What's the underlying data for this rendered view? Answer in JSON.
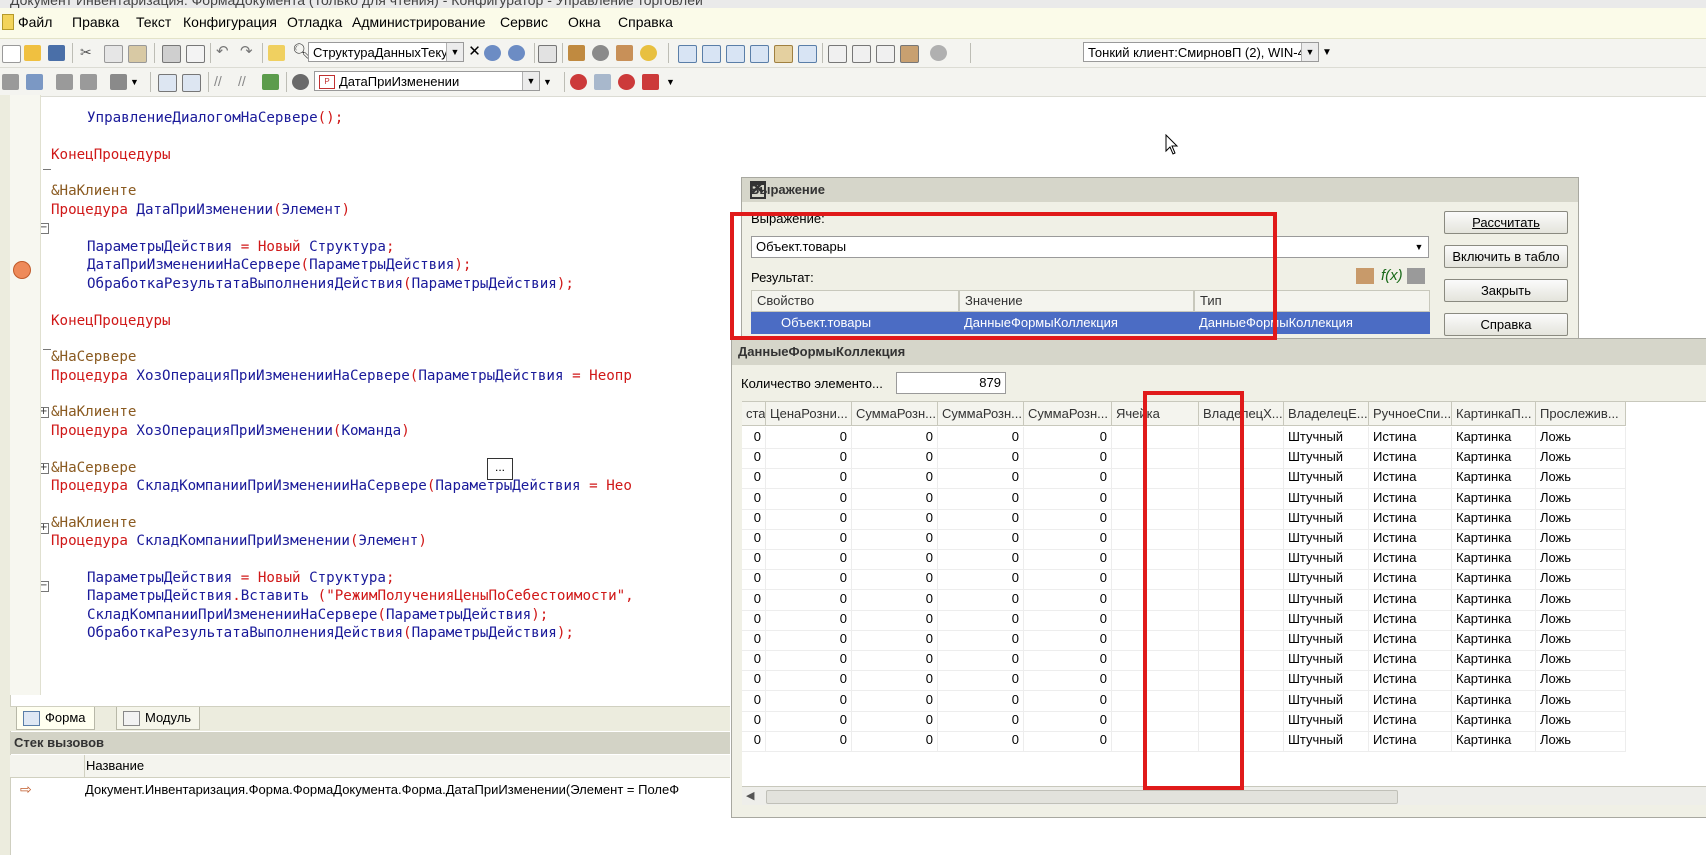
{
  "window_title": "Документ Инвентаризация: ФормаДокумента (Только для чтения) - Конфигуратор - Управление торговлей",
  "menu": [
    "Файл",
    "Правка",
    "Текст",
    "Конфигурация",
    "Отладка",
    "Администрирование",
    "Сервис",
    "Окна",
    "Справка"
  ],
  "toolbar1": {
    "search_combo": "СтруктураДанныхТеку",
    "client_combo": "Тонкий клиент:СмирновП (2), WIN-4"
  },
  "toolbar2": {
    "procedure_combo": "ДатаПриИзменении"
  },
  "code": {
    "lines": [
      {
        "indent": 2,
        "parts": [
          {
            "t": "УправлениеДиалогомНаСервере",
            "c": "id"
          },
          {
            "t": "();",
            "c": "kw"
          }
        ]
      },
      {
        "indent": 0,
        "parts": [
          {
            "t": "КонецПроцедуры",
            "c": "kw"
          }
        ]
      },
      {
        "indent": 0,
        "parts": [
          {
            "t": "&НаКлиенте",
            "c": "dir"
          }
        ]
      },
      {
        "indent": 0,
        "parts": [
          {
            "t": "Процедура ",
            "c": "kw"
          },
          {
            "t": "ДатаПриИзменении",
            "c": "id"
          },
          {
            "t": "(",
            "c": "kw"
          },
          {
            "t": "Элемент",
            "c": "id"
          },
          {
            "t": ")",
            "c": "kw"
          }
        ]
      },
      {
        "indent": 2,
        "parts": [
          {
            "t": "ПараметрыДействия",
            "c": "id"
          },
          {
            "t": " = Новый ",
            "c": "kw"
          },
          {
            "t": "Структура",
            "c": "id"
          },
          {
            "t": ";",
            "c": "kw"
          }
        ]
      },
      {
        "indent": 2,
        "parts": [
          {
            "t": "ДатаПриИзмененииНаСервере",
            "c": "id"
          },
          {
            "t": "(",
            "c": "kw"
          },
          {
            "t": "ПараметрыДействия",
            "c": "id"
          },
          {
            "t": ");",
            "c": "kw"
          }
        ]
      },
      {
        "indent": 2,
        "parts": [
          {
            "t": "ОбработкаРезультатаВыполненияДействия",
            "c": "id"
          },
          {
            "t": "(",
            "c": "kw"
          },
          {
            "t": "ПараметрыДействия",
            "c": "id"
          },
          {
            "t": ");",
            "c": "kw"
          }
        ]
      },
      {
        "indent": 0,
        "parts": [
          {
            "t": "КонецПроцедуры",
            "c": "kw"
          }
        ]
      },
      {
        "indent": 0,
        "parts": [
          {
            "t": "&НаСервере",
            "c": "dir"
          }
        ]
      },
      {
        "indent": 0,
        "parts": [
          {
            "t": "Процедура ",
            "c": "kw"
          },
          {
            "t": "ХозОперацияПриИзмененииНаСервере",
            "c": "id"
          },
          {
            "t": "(",
            "c": "kw"
          },
          {
            "t": "ПараметрыДействия",
            "c": "id"
          },
          {
            "t": " = Неопр",
            "c": "kw"
          }
        ]
      },
      {
        "indent": 0,
        "parts": [
          {
            "t": "&НаКлиенте",
            "c": "dir"
          }
        ]
      },
      {
        "indent": 0,
        "parts": [
          {
            "t": "Процедура ",
            "c": "kw"
          },
          {
            "t": "ХозОперацияПриИзменении",
            "c": "id"
          },
          {
            "t": "(",
            "c": "kw"
          },
          {
            "t": "Команда",
            "c": "id"
          },
          {
            "t": ")",
            "c": "kw"
          }
        ]
      },
      {
        "indent": 0,
        "parts": [
          {
            "t": "&НаСервере",
            "c": "dir"
          }
        ]
      },
      {
        "indent": 0,
        "parts": [
          {
            "t": "Процедура ",
            "c": "kw"
          },
          {
            "t": "СкладКомпанииПриИзмененииНаСервере",
            "c": "id"
          },
          {
            "t": "(",
            "c": "kw"
          },
          {
            "t": "ПараметрыДействия",
            "c": "id"
          },
          {
            "t": " = Нео",
            "c": "kw"
          }
        ]
      },
      {
        "indent": 0,
        "parts": [
          {
            "t": "&НаКлиенте",
            "c": "dir"
          }
        ]
      },
      {
        "indent": 0,
        "parts": [
          {
            "t": "Процедура ",
            "c": "kw"
          },
          {
            "t": "СкладКомпанииПриИзменении",
            "c": "id"
          },
          {
            "t": "(",
            "c": "kw"
          },
          {
            "t": "Элемент",
            "c": "id"
          },
          {
            "t": ")",
            "c": "kw"
          }
        ]
      },
      {
        "indent": 2,
        "parts": [
          {
            "t": "ПараметрыДействия",
            "c": "id"
          },
          {
            "t": " = Новый ",
            "c": "kw"
          },
          {
            "t": "Структура",
            "c": "id"
          },
          {
            "t": ";",
            "c": "kw"
          }
        ]
      },
      {
        "indent": 2,
        "parts": [
          {
            "t": "ПараметрыДействия",
            "c": "id"
          },
          {
            "t": ".",
            "c": "kw"
          },
          {
            "t": "Вставить",
            "c": "id"
          },
          {
            "t": " (\"РежимПолученияЦеныПоСебестоимости\",",
            "c": "kw"
          }
        ]
      },
      {
        "indent": 2,
        "parts": [
          {
            "t": "СкладКомпанииПриИзмененииНаСервере",
            "c": "id"
          },
          {
            "t": "(",
            "c": "kw"
          },
          {
            "t": "ПараметрыДействия",
            "c": "id"
          },
          {
            "t": ");",
            "c": "kw"
          }
        ]
      },
      {
        "indent": 2,
        "parts": [
          {
            "t": "ОбработкаРезультатаВыполненияДействия",
            "c": "id"
          },
          {
            "t": "(",
            "c": "kw"
          },
          {
            "t": "ПараметрыДействия",
            "c": "id"
          },
          {
            "t": ");",
            "c": "kw"
          }
        ]
      }
    ],
    "collapsed_marker": "..."
  },
  "tabs": [
    {
      "label": "Форма",
      "active": true
    },
    {
      "label": "Модуль",
      "active": false
    }
  ],
  "stack": {
    "title": "Стек вызовов",
    "column": "Название",
    "row": "Документ.Инвентаризация.Форма.ФормаДокумента.Форма.ДатаПриИзменении(Элемент = ПолеФ"
  },
  "dialog": {
    "title": "Выражение",
    "expr_label": "Выражение:",
    "expr_value": "Объект.товары",
    "result_label": "Результат:",
    "columns": [
      "Свойство",
      "Значение",
      "Тип"
    ],
    "row": [
      "Объект.товары",
      "ДанныеФормыКоллекция",
      "ДанныеФормыКоллекция"
    ],
    "buttons": [
      "Рассчитать",
      "Включить в табло",
      "Закрыть",
      "Справка"
    ]
  },
  "collection": {
    "title": "ДанныеФормыКоллекция",
    "count_label": "Количество элементо...",
    "count_value": "879",
    "columns": [
      "ста",
      "ЦенаРозни...",
      "СуммаРозн...",
      "СуммаРозн...",
      "СуммаРозн...",
      "Ячейка",
      "ВладелецХ...",
      "ВладелецЕ...",
      "РучноеСпи...",
      "КартинкаП...",
      "Прослежив..."
    ],
    "row_template": [
      "0",
      "0",
      "0",
      "0",
      "0",
      "",
      "",
      "Штучный",
      "Истина",
      "Картинка",
      "Ложь"
    ],
    "visible_rows": 16
  },
  "colors": {
    "keyword": "#d01818",
    "identifier": "#1a1a9a",
    "selection": "#4b6cc4",
    "highlight": "#e01a1a"
  }
}
